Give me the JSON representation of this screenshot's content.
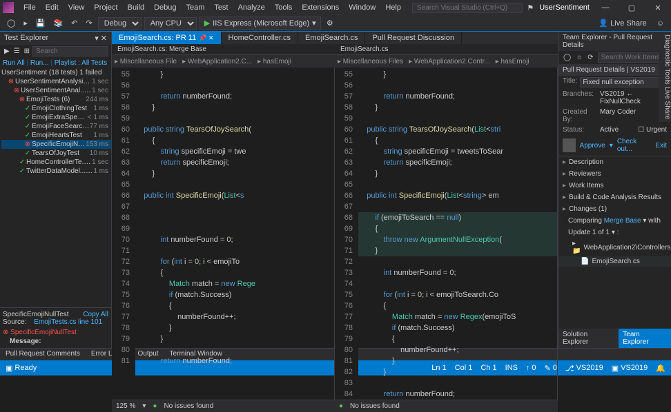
{
  "menu": [
    "File",
    "Edit",
    "View",
    "Project",
    "Build",
    "Debug",
    "Team",
    "Test",
    "Analyze",
    "Tools",
    "Extensions",
    "Window",
    "Help"
  ],
  "search_placeholder": "Search Visual Studio (Ctrl+Q)",
  "solution_name": "UserSentiment",
  "toolbar": {
    "config": "Debug",
    "platform": "Any CPU",
    "launch": "IIS Express (Microsoft Edge)",
    "share": "Live Share"
  },
  "test_explorer": {
    "title": "Test Explorer",
    "search": "Search",
    "links": [
      "Run All",
      "Run...",
      "Playlist : All Tests"
    ],
    "root": "UserSentiment (18 tests) 1 failed",
    "nodes": [
      {
        "indent": 1,
        "status": "fail",
        "name": "UserSentimentAnalysis... (18)",
        "time": "1 sec"
      },
      {
        "indent": 2,
        "status": "fail",
        "name": "UserSentimentAnal... (18)",
        "time": "1 sec"
      },
      {
        "indent": 3,
        "status": "fail",
        "name": "EmojiTests (6)",
        "time": "244 ms"
      },
      {
        "indent": 4,
        "status": "pass",
        "name": "EmojiClothingTest",
        "time": "1 ms"
      },
      {
        "indent": 4,
        "status": "pass",
        "name": "EmojiExtraSpecial...",
        "time": "< 1 ms"
      },
      {
        "indent": 4,
        "status": "pass",
        "name": "EmojiFaceSearchTest",
        "time": "77 ms"
      },
      {
        "indent": 4,
        "status": "pass",
        "name": "EmojiHeartsTest",
        "time": "1 ms"
      },
      {
        "indent": 4,
        "status": "fail",
        "name": "SpecificEmojiNullT...",
        "time": "153 ms",
        "sel": true
      },
      {
        "indent": 4,
        "status": "pass",
        "name": "TearsOfJoyTest",
        "time": "10 ms"
      },
      {
        "indent": 3,
        "status": "pass",
        "name": "HomeControllerTe... (6)",
        "time": "1 sec"
      },
      {
        "indent": 3,
        "status": "pass",
        "name": "TwitterDataModel... (6)",
        "time": "1 ms"
      }
    ],
    "detail": {
      "name": "SpecificEmojiNullTest",
      "copy": "Copy All",
      "source_label": "Source:",
      "source": "EmojiTests.cs line 101",
      "failed": "SpecificEmojiNullTest",
      "msg_label": "Message:"
    }
  },
  "tabs": [
    {
      "label": "EmojiSearch.cs: PR 11",
      "active": true
    },
    {
      "label": "HomeController.cs"
    },
    {
      "label": "EmojiSearch.cs"
    },
    {
      "label": "Pull Request Discussion"
    }
  ],
  "subtabs": [
    "EmojiSearch.cs: Merge Base",
    "EmojiSearch.cs"
  ],
  "breadcrumb_left": [
    "Miscellaneous File",
    "WebApplication2.C...",
    "hasEmoji"
  ],
  "breadcrumb_right": [
    "Miscellaneous Files",
    "WebApplication2.Contr...",
    "hasEmoji"
  ],
  "left_lines": [
    {
      "n": 55,
      "t": "            }"
    },
    {
      "n": 56,
      "t": ""
    },
    {
      "n": 57,
      "t": "            <kw>return</kw> numberFound;"
    },
    {
      "n": 58,
      "t": "        }"
    },
    {
      "n": 59,
      "t": ""
    },
    {
      "n": 60,
      "t": "    <kw>public</kw> <kw>string</kw> <method>TearsOfJoySearch</method>("
    },
    {
      "n": 61,
      "t": "        {"
    },
    {
      "n": 62,
      "t": "            <kw>string</kw> specificEmoji = twe"
    },
    {
      "n": 63,
      "t": "            <kw>return</kw> specificEmoji;"
    },
    {
      "n": 64,
      "t": "        }"
    },
    {
      "n": 65,
      "t": ""
    },
    {
      "n": 66,
      "t": "    <kw>public</kw> <kw>int</kw> <method>SpecificEmoji</method>(<type>List</type>&lt;<kw>s</kw>"
    },
    {
      "n": 67,
      "t": ""
    },
    {
      "n": 68,
      "t": ""
    },
    {
      "n": 69,
      "t": ""
    },
    {
      "n": 70,
      "t": "            <kw>int</kw> numberFound = <num>0</num>;"
    },
    {
      "n": 71,
      "t": ""
    },
    {
      "n": 72,
      "t": "            <kw>for</kw> (<kw>int</kw> i = <num>0</num>; i &lt; emojiTo"
    },
    {
      "n": 73,
      "t": "            {"
    },
    {
      "n": 74,
      "t": "                <type>Match</type> match = <kw>new</kw> <type>Rege</type>"
    },
    {
      "n": 75,
      "t": "                <kw>if</kw> (match.Success)"
    },
    {
      "n": 76,
      "t": "                {"
    },
    {
      "n": 77,
      "t": "                    numberFound++;"
    },
    {
      "n": 78,
      "t": "                }"
    },
    {
      "n": 79,
      "t": "            }"
    },
    {
      "n": 80,
      "t": ""
    },
    {
      "n": 81,
      "t": "            <kw>return</kw> numberFound;"
    }
  ],
  "right_lines": [
    {
      "n": 55,
      "t": "            }"
    },
    {
      "n": 56,
      "t": ""
    },
    {
      "n": 57,
      "t": "            <kw>return</kw> numberFound;"
    },
    {
      "n": 58,
      "t": "        }"
    },
    {
      "n": 59,
      "t": ""
    },
    {
      "n": 60,
      "t": "    <kw>public</kw> <kw>string</kw> <method>TearsOfJoySearch</method>(<type>List</type>&lt;<kw>stri</kw>"
    },
    {
      "n": 61,
      "t": "        {"
    },
    {
      "n": 62,
      "t": "            <kw>string</kw> specificEmoji = tweetsToSear"
    },
    {
      "n": 63,
      "t": "            <kw>return</kw> specificEmoji;"
    },
    {
      "n": 64,
      "t": "        }"
    },
    {
      "n": 65,
      "t": ""
    },
    {
      "n": 66,
      "t": "    <kw>public</kw> <kw>int</kw> <method>SpecificEmoji</method>(<type>List</type>&lt;<kw>string</kw>&gt; em"
    },
    {
      "n": 67,
      "t": ""
    },
    {
      "n": 68,
      "t": "        <kw>if</kw> (emojiToSearch == <kw>null</kw>)",
      "hl": true
    },
    {
      "n": 69,
      "t": "        {",
      "hl": true
    },
    {
      "n": 70,
      "t": "            <kw>throw</kw> <kw>new</kw> <type>ArgumentNullException</type>(",
      "hl": true
    },
    {
      "n": 71,
      "t": "        }",
      "hl": true
    },
    {
      "n": 72,
      "t": ""
    },
    {
      "n": 73,
      "t": "            <kw>int</kw> numberFound = <num>0</num>;"
    },
    {
      "n": 74,
      "t": ""
    },
    {
      "n": 75,
      "t": "            <kw>for</kw> (<kw>int</kw> i = <num>0</num>; i &lt; emojiToSearch.Co"
    },
    {
      "n": 76,
      "t": "            {"
    },
    {
      "n": 77,
      "t": "                <type>Match</type> match = <kw>new</kw> <type>Regex</type>(emojiToS"
    },
    {
      "n": 78,
      "t": "                <kw>if</kw> (match.Success)"
    },
    {
      "n": 79,
      "t": "                {"
    },
    {
      "n": 80,
      "t": "                    numberFound++;"
    },
    {
      "n": 81,
      "t": "                }"
    },
    {
      "n": 82,
      "t": "            }"
    },
    {
      "n": 83,
      "t": ""
    },
    {
      "n": 84,
      "t": "            <kw>return</kw> numberFound;"
    }
  ],
  "editor_status": {
    "zoom": "125 %",
    "issues": "No issues found"
  },
  "team": {
    "header": "Team Explorer - Pull Request Details",
    "search": "Search Work Items",
    "title_section": "Pull Request Details",
    "vs": "VS2019",
    "title_label": "Title:",
    "title_value": "Fixed null exception",
    "branches_label": "Branches:",
    "branches_value": "VS2019 ← FixNullCheck",
    "created_label": "Created By:",
    "created_value": "Mary Coder",
    "status_label": "Status:",
    "status_value": "Active",
    "urgent": "Urgent",
    "approve": "Approve",
    "checkout": "Check out...",
    "exit": "Exit",
    "sections": [
      "Description",
      "Reviewers",
      "Work Items",
      "Build & Code Analysis Results",
      "Changes (1)"
    ],
    "comparing": "Comparing",
    "merge": "Merge Base",
    "with": "with",
    "update": "Update 1 of 1",
    "folder": "WebApplication2\\Controllers",
    "file": "EmojiSearch.cs",
    "bottom_tabs": [
      "Solution Explorer",
      "Team Explorer"
    ]
  },
  "out_tabs": [
    "Pull Request Comments",
    "Error List ...",
    "Output",
    "Terminal Window"
  ],
  "statusbar": {
    "ready": "Ready",
    "ln": "Ln 1",
    "col": "Col 1",
    "ch": "Ch 1",
    "ins": "INS",
    "up": "0",
    "down": "0",
    "branch": "VS2019",
    "repo": "VS2019"
  },
  "side_tools": "Diagnostic Tools   Live Share"
}
